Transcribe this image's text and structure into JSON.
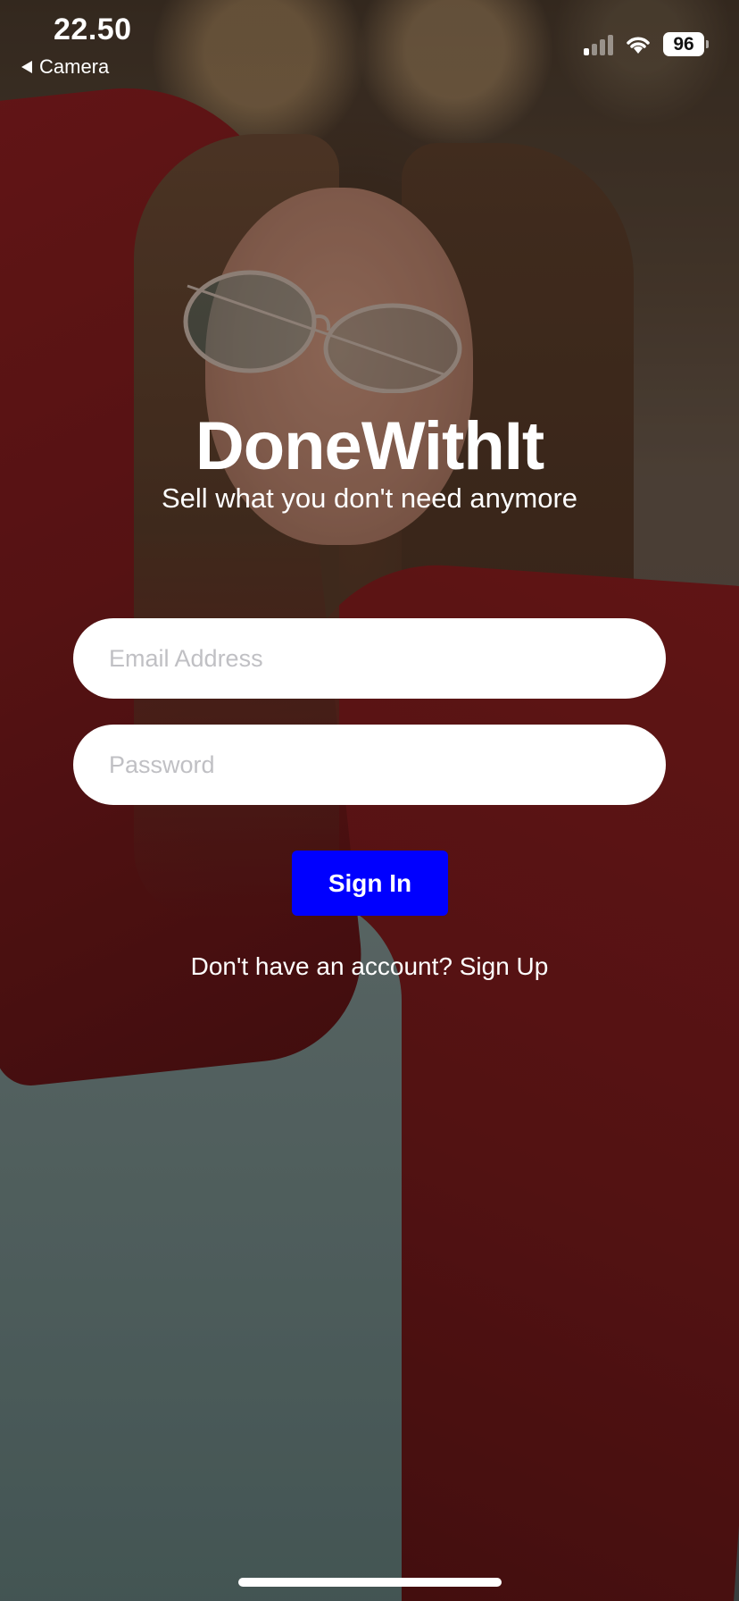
{
  "status_bar": {
    "time": "22.50",
    "back_label": "Camera",
    "battery": "96"
  },
  "app": {
    "title": "DoneWithIt",
    "tagline": "Sell what you don't need anymore"
  },
  "form": {
    "email_placeholder": "Email Address",
    "password_placeholder": "Password",
    "sign_in_label": "Sign In",
    "signup_prompt": "Don't have an account? Sign Up"
  },
  "colors": {
    "primary_button": "#0000ff",
    "input_background": "#ffffff",
    "text": "#ffffff"
  }
}
